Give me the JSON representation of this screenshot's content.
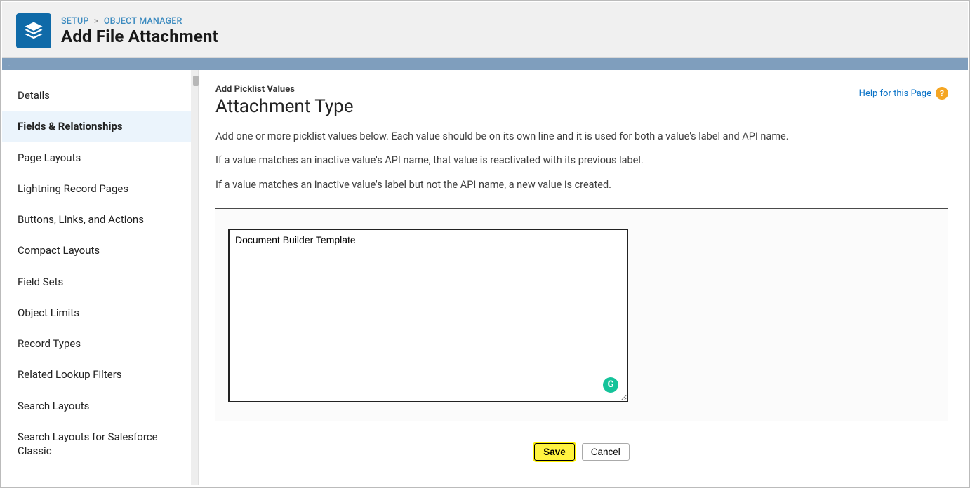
{
  "header": {
    "breadcrumb_setup": "SETUP",
    "breadcrumb_sep": ">",
    "breadcrumb_objmgr": "OBJECT MANAGER",
    "title": "Add File Attachment"
  },
  "sidebar": {
    "items": [
      {
        "label": "Details",
        "active": false
      },
      {
        "label": "Fields & Relationships",
        "active": true
      },
      {
        "label": "Page Layouts",
        "active": false
      },
      {
        "label": "Lightning Record Pages",
        "active": false
      },
      {
        "label": "Buttons, Links, and Actions",
        "active": false
      },
      {
        "label": "Compact Layouts",
        "active": false
      },
      {
        "label": "Field Sets",
        "active": false
      },
      {
        "label": "Object Limits",
        "active": false
      },
      {
        "label": "Record Types",
        "active": false
      },
      {
        "label": "Related Lookup Filters",
        "active": false
      },
      {
        "label": "Search Layouts",
        "active": false
      },
      {
        "label": "Search Layouts for Salesforce Classic",
        "active": false
      }
    ]
  },
  "content": {
    "pretitle": "Add Picklist Values",
    "title": "Attachment Type",
    "help_label": "Help for this Page",
    "help_icon": "?",
    "desc": [
      "Add one or more picklist values below. Each value should be on its own line and it is used for both a value's label and API name.",
      "If a value matches an inactive value's API name, that value is reactivated with its previous label.",
      "If a value matches an inactive value's label but not the API name, a new value is created."
    ],
    "textarea_value": "Document Builder Template",
    "grammarly": "G",
    "save_label": "Save",
    "cancel_label": "Cancel"
  }
}
